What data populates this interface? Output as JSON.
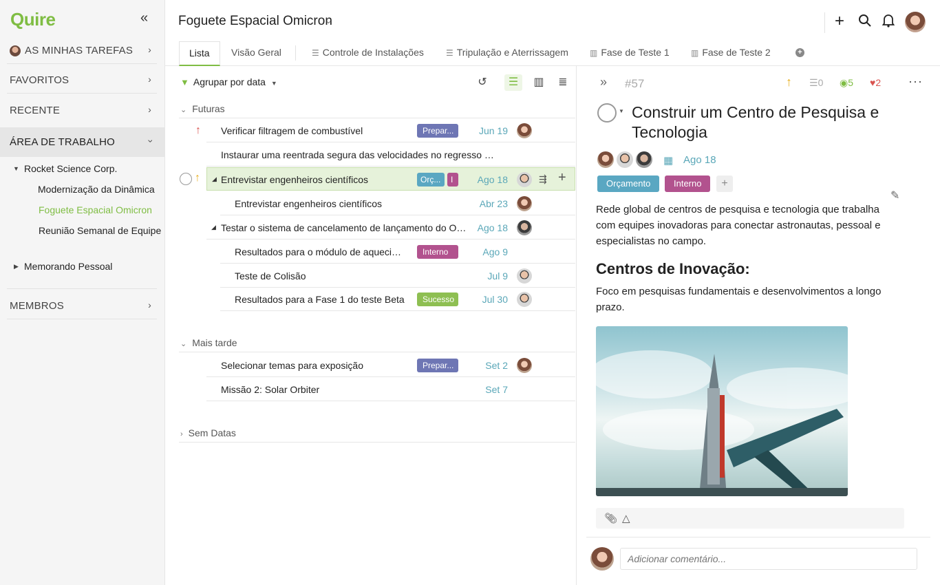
{
  "app": {
    "name": "Quire"
  },
  "colors": {
    "brand": "#7fbd43",
    "date": "#5aa7b8",
    "tag_preparacao": "#6e76b4",
    "tag_orcamento": "#5aa7c2",
    "tag_interno": "#b2528e",
    "tag_sucesso": "#8ebf52"
  },
  "sidebar": {
    "collapse_icon": "double-chevron-left-icon",
    "my_tasks": "AS MINHAS TAREFAS",
    "favorites": "FAVORITOS",
    "recent": "RECENTE",
    "workspace": "ÁREA DE TRABALHO",
    "org": "Rocket Science Corp.",
    "projects": [
      "Modernização da Dinâmica",
      "Foguete Espacial Omicron",
      "Reunião Semanal de Equipe"
    ],
    "personal": "Memorando Pessoal",
    "members": "MEMBROS"
  },
  "header": {
    "project_title": "Foguete Espacial Omicron",
    "tabs": [
      "Lista",
      "Visão Geral",
      "Controle de Instalações",
      "Tripulação e Aterrissagem",
      "Fase de Teste 1",
      "Fase de Teste 2"
    ]
  },
  "list": {
    "filter_label": "Agrupar por data",
    "groups": {
      "future": "Futuras",
      "later": "Mais tarde",
      "nodate": "Sem Datas"
    },
    "rows": [
      {
        "title": "Verificar filtragem de combustível",
        "tag": "Prepar...",
        "date": "Jun 19"
      },
      {
        "title": "Instaurar uma reentrada segura das velocidades no regresso do...",
        "tag": "",
        "date": ""
      },
      {
        "title": "Entrevistar engenheiros científicos",
        "tag": "Orç...",
        "tag2": "I",
        "date": "Ago 18"
      },
      {
        "title": "Entrevistar engenheiros científicos",
        "tag": "",
        "date": "Abr 23"
      },
      {
        "title": "Testar o sistema de cancelamento de lançamento do Omi...",
        "tag": "",
        "date": "Ago 18"
      },
      {
        "title": "Resultados para o módulo de aquecime...",
        "tag": "Interno",
        "date": "Ago 9"
      },
      {
        "title": "Teste de Colisão",
        "tag": "",
        "date": "Jul 9"
      },
      {
        "title": "Resultados para a Fase 1 do teste Beta",
        "tag": "Sucesso",
        "date": "Jul 30"
      },
      {
        "title": "Selecionar temas para exposição",
        "tag": "Prepar...",
        "date": "Set 2"
      },
      {
        "title": "Missão 2: Solar Orbiter",
        "tag": "",
        "date": "Set 7"
      }
    ]
  },
  "detail": {
    "id": "#57",
    "subtasks_count": "0",
    "watchers_count": "5",
    "likes_count": "2",
    "title": "Construir um Centro de Pesquisa e Tecnologia",
    "due": "Ago 18",
    "tags": [
      "Orçamento",
      "Interno"
    ],
    "description": "Rede global de centros de pesquisa e tecnologia que trabalha com equipes inovadoras para conectar astronautas, pessoal e especialistas no campo.",
    "heading": "Centros de Inovação:",
    "paragraph": "Foco em pesquisas fundamentais e desenvolvimentos a longo prazo.",
    "comment_placeholder": "Adicionar comentário..."
  }
}
